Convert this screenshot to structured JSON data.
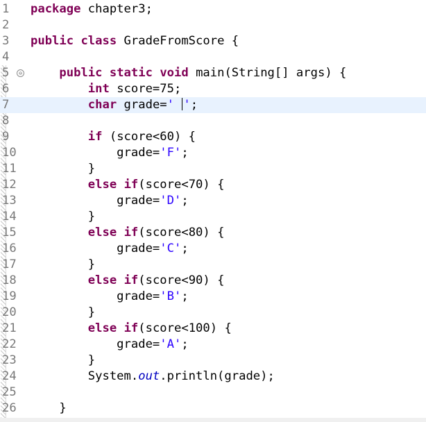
{
  "editor": {
    "file": "GradeFromScore.java",
    "lines": [
      {
        "n": "1",
        "tokens": [
          {
            "t": "package",
            "c": "kw"
          },
          {
            "t": " chapter3;"
          }
        ]
      },
      {
        "n": "2",
        "tokens": []
      },
      {
        "n": "3",
        "tokens": [
          {
            "t": "public",
            "c": "kw"
          },
          {
            "t": " "
          },
          {
            "t": "class",
            "c": "kw"
          },
          {
            "t": " GradeFromScore {"
          }
        ]
      },
      {
        "n": "4",
        "tokens": []
      },
      {
        "n": "5",
        "fold": "⊖",
        "tokens": [
          {
            "t": "    "
          },
          {
            "t": "public",
            "c": "kw"
          },
          {
            "t": " "
          },
          {
            "t": "static",
            "c": "kw"
          },
          {
            "t": " "
          },
          {
            "t": "void",
            "c": "kw"
          },
          {
            "t": " main(String[] args) {"
          }
        ]
      },
      {
        "n": "6",
        "tokens": [
          {
            "t": "        "
          },
          {
            "t": "int",
            "c": "kw"
          },
          {
            "t": " score=75;"
          }
        ]
      },
      {
        "n": "7",
        "current": true,
        "tokens": [
          {
            "t": "        "
          },
          {
            "t": "char",
            "c": "kw"
          },
          {
            "t": " grade="
          },
          {
            "t": "' ",
            "c": "str"
          },
          {
            "caret": true
          },
          {
            "t": "'",
            "c": "str"
          },
          {
            "t": ";"
          }
        ]
      },
      {
        "n": "8",
        "tokens": []
      },
      {
        "n": "9",
        "tokens": [
          {
            "t": "        "
          },
          {
            "t": "if",
            "c": "kw"
          },
          {
            "t": " (score<60) {"
          }
        ]
      },
      {
        "n": "10",
        "tokens": [
          {
            "t": "            grade="
          },
          {
            "t": "'F'",
            "c": "str"
          },
          {
            "t": ";"
          }
        ]
      },
      {
        "n": "11",
        "tokens": [
          {
            "t": "        }"
          }
        ]
      },
      {
        "n": "12",
        "tokens": [
          {
            "t": "        "
          },
          {
            "t": "else",
            "c": "kw"
          },
          {
            "t": " "
          },
          {
            "t": "if",
            "c": "kw"
          },
          {
            "t": "(score<70) {"
          }
        ]
      },
      {
        "n": "13",
        "tokens": [
          {
            "t": "            grade="
          },
          {
            "t": "'D'",
            "c": "str"
          },
          {
            "t": ";"
          }
        ]
      },
      {
        "n": "14",
        "tokens": [
          {
            "t": "        }"
          }
        ]
      },
      {
        "n": "15",
        "tokens": [
          {
            "t": "        "
          },
          {
            "t": "else",
            "c": "kw"
          },
          {
            "t": " "
          },
          {
            "t": "if",
            "c": "kw"
          },
          {
            "t": "(score<80) {"
          }
        ]
      },
      {
        "n": "16",
        "tokens": [
          {
            "t": "            grade="
          },
          {
            "t": "'C'",
            "c": "str"
          },
          {
            "t": ";"
          }
        ]
      },
      {
        "n": "17",
        "tokens": [
          {
            "t": "        }"
          }
        ]
      },
      {
        "n": "18",
        "tokens": [
          {
            "t": "        "
          },
          {
            "t": "else",
            "c": "kw"
          },
          {
            "t": " "
          },
          {
            "t": "if",
            "c": "kw"
          },
          {
            "t": "(score<90) {"
          }
        ]
      },
      {
        "n": "19",
        "tokens": [
          {
            "t": "            grade="
          },
          {
            "t": "'B'",
            "c": "str"
          },
          {
            "t": ";"
          }
        ]
      },
      {
        "n": "20",
        "tokens": [
          {
            "t": "        }"
          }
        ]
      },
      {
        "n": "21",
        "tokens": [
          {
            "t": "        "
          },
          {
            "t": "else",
            "c": "kw"
          },
          {
            "t": " "
          },
          {
            "t": "if",
            "c": "kw"
          },
          {
            "t": "(score<100) {"
          }
        ]
      },
      {
        "n": "22",
        "tokens": [
          {
            "t": "            grade="
          },
          {
            "t": "'A'",
            "c": "str"
          },
          {
            "t": ";"
          }
        ]
      },
      {
        "n": "23",
        "tokens": [
          {
            "t": "        }"
          }
        ]
      },
      {
        "n": "24",
        "tokens": [
          {
            "t": "        System."
          },
          {
            "t": "out",
            "c": "fld"
          },
          {
            "t": ".println(grade);"
          }
        ]
      },
      {
        "n": "25",
        "tokens": []
      },
      {
        "n": "26",
        "tokens": [
          {
            "t": "    }"
          }
        ]
      }
    ]
  },
  "colors": {
    "keyword": "#7f0055",
    "string": "#2a00ff",
    "field": "#0000c0",
    "line_number": "#787878",
    "current_line": "#e8f2fe"
  }
}
